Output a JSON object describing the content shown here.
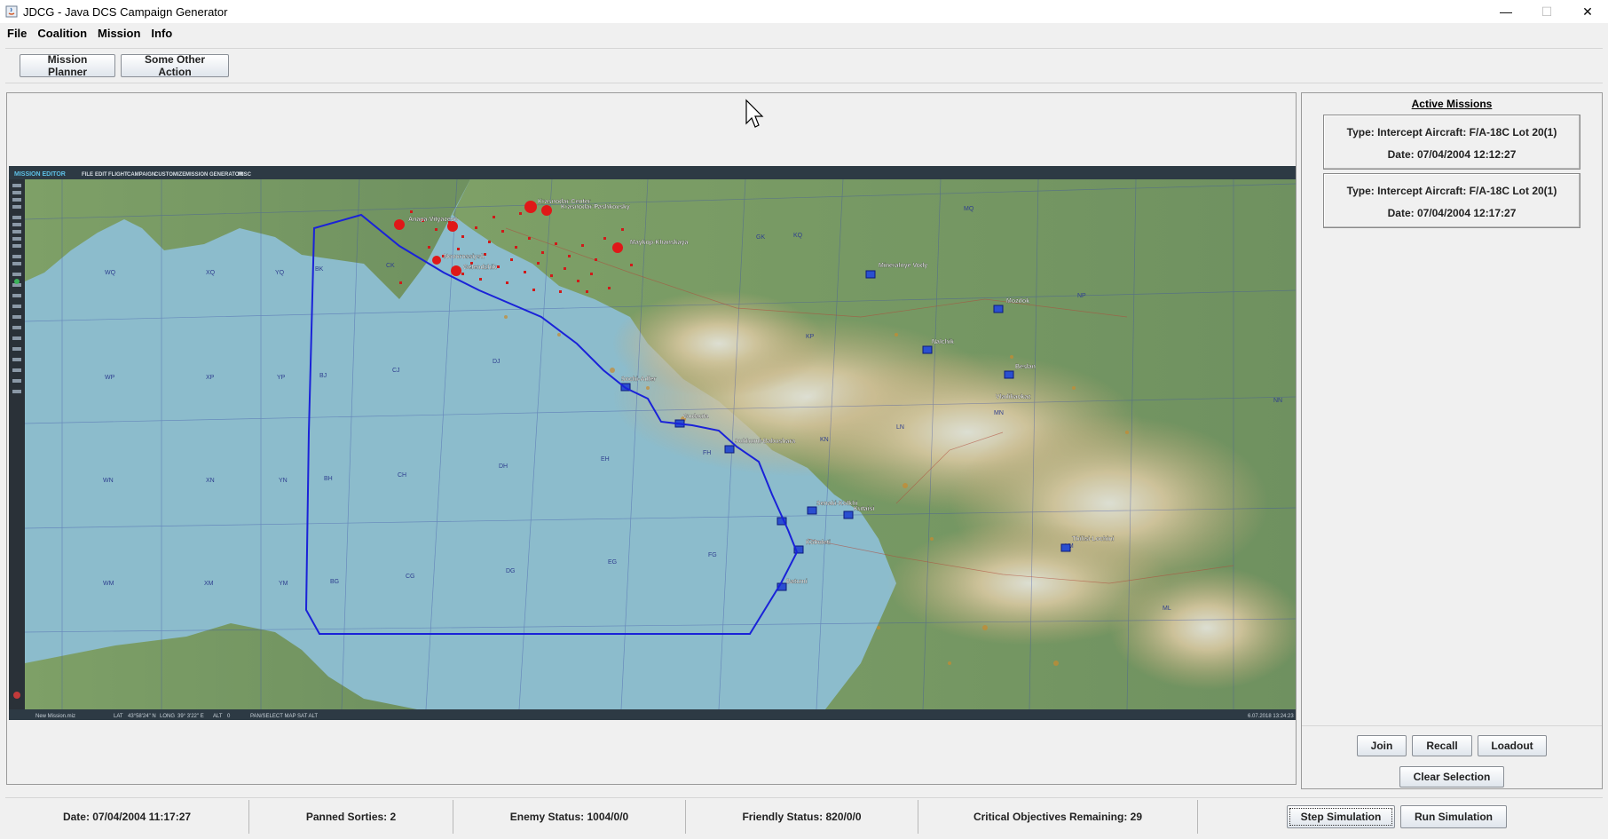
{
  "window": {
    "title": "JDCG - Java DCS Campaign Generator",
    "minimize_glyph": "—",
    "maximize_glyph": "☐",
    "close_glyph": "✕"
  },
  "menubar": [
    "File",
    "Coalition",
    "Mission",
    "Info"
  ],
  "toolbar": {
    "mission_planner": "Mission Planner",
    "other_action": "Some Other Action"
  },
  "map": {
    "editor_title": "MISSION EDITOR",
    "editor_menu": [
      "FILE",
      "EDIT",
      "FLIGHT",
      "CAMPAIGN",
      "CUSTOMIZE",
      "MISSION GENERATOR",
      "MISC"
    ],
    "status_strip": {
      "mission": "New Mission.miz",
      "lat_label": "LAT",
      "lat": "43°58'24\" N",
      "long_label": "LONG",
      "long": "39° 3'22\" E",
      "alt_label": "ALT",
      "alt": "0",
      "modes": "PAN/SELECT   MAP   SAT   ALT",
      "timestamp": "6.07.2018 13:24:23"
    },
    "cities": [
      "Krasnodar-Center",
      "Krasnodar-Pashkovsky",
      "Anapa-Vityazevo",
      "Novorossiysk",
      "Gelendzhik",
      "Maykop-Khanskaya",
      "Mineralnye Vody",
      "Nalchik",
      "Mozdok",
      "Beslan",
      "Vladikavkaz",
      "Sochi-Adler",
      "Gudauta",
      "Sukhumi-Babushara",
      "Senaki-Kolkhi",
      "Kutaisi",
      "Kobuleti",
      "Batumi",
      "Tbilisi-Lochini"
    ],
    "grid_labels": [
      "WQ",
      "XQ",
      "YQ",
      "BK",
      "CK",
      "WP",
      "XP",
      "YP",
      "BJ",
      "CJ",
      "DJ",
      "WN",
      "XN",
      "YN",
      "BH",
      "CH",
      "DH",
      "EH",
      "FH",
      "WM",
      "XM",
      "YM",
      "BG",
      "CG",
      "DG",
      "EG",
      "FG",
      "GK",
      "KQ",
      "MQ",
      "NP",
      "KP",
      "MN",
      "LN",
      "KN",
      "NN",
      "ML",
      "LM"
    ],
    "colors": {
      "sea": "#8cbccc",
      "land": "#7d9b66",
      "mountain": "#c4ab79",
      "snow": "#e8ebe6",
      "zone": "#1a22d8",
      "red": "#e01818",
      "blue_unit": "#2a4fd0",
      "editor_bar": "#2d3a44"
    }
  },
  "active_missions": {
    "heading": "Active Missions",
    "items": [
      {
        "type_line": "Type: Intercept  Aircraft: F/A-18C Lot 20(1)",
        "date_line": "Date: 07/04/2004 12:12:27"
      },
      {
        "type_line": "Type: Intercept  Aircraft: F/A-18C Lot 20(1)",
        "date_line": "Date: 07/04/2004 12:17:27"
      }
    ],
    "buttons": {
      "join": "Join",
      "recall": "Recall",
      "loadout": "Loadout",
      "clear": "Clear Selection"
    }
  },
  "status": {
    "date": "Date: 07/04/2004 11:17:27",
    "sorties": "Panned Sorties: 2",
    "enemy": "Enemy Status: 1004/0/0",
    "friendly": "Friendly Status: 820/0/0",
    "objectives": "Critical Objectives Remaining: 29",
    "step": "Step Simulation",
    "run": "Run Simulation"
  }
}
